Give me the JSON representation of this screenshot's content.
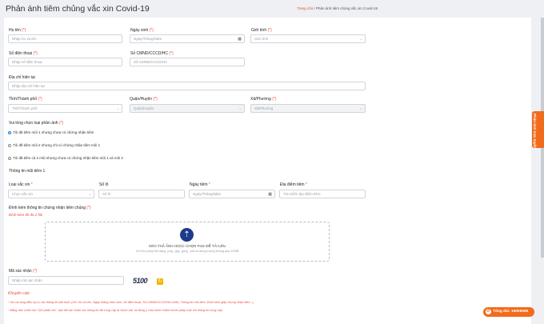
{
  "page": {
    "title": "Phản ánh tiêm chủng vắc xin Covid-19"
  },
  "breadcrumb": {
    "home": "Trang chủ",
    "sep": "/",
    "current": "Phản ánh tiêm chủng vắc xin Covid-19"
  },
  "form": {
    "full_name": {
      "label": "Họ tên",
      "req": "(*)",
      "placeholder": "Nhập họ và tên"
    },
    "dob": {
      "label": "Ngày sinh",
      "req": "(*)",
      "placeholder": "Ngày/Tháng/Năm"
    },
    "gender": {
      "label": "Giới tính",
      "req": "(*)",
      "value": "Giới tính"
    },
    "phone": {
      "label": "Số điện thoại",
      "req": "(*)",
      "placeholder": "Nhập số điện thoại"
    },
    "id_number": {
      "label": "Số CMND/CCCD/HC",
      "req": "(*)",
      "placeholder": "Số CMND/CCCD/HC"
    },
    "address": {
      "label": "Địa chỉ hiện tại",
      "placeholder": "Nhập địa chỉ hiện tại"
    },
    "province": {
      "label": "Tỉnh/Thành phố",
      "req": "(*)",
      "value": "Tỉnh/Thành phố"
    },
    "district": {
      "label": "Quận/Huyện",
      "req": "(*)",
      "value": "Quận/Huyện"
    },
    "ward": {
      "label": "Xã/Phường",
      "req": "(*)",
      "value": "Xã/Phường"
    },
    "report_type": {
      "label": "Vui lòng chọn loại phản ánh",
      "req": "(*)",
      "options": [
        "Tôi đã tiêm mũi 1 nhưng chưa có chứng nhận tiêm",
        "Tôi đã tiêm mũi 2 nhưng chỉ có chứng nhận tiêm mũi 1",
        "Tôi đã tiêm cả 2 mũi nhưng chưa có chứng nhận tiêm mũi 1 và mũi 2"
      ]
    },
    "dose_section": "Thông tin mũi tiêm 1",
    "vaccine": {
      "label": "Loại vắc xin",
      "req": "*",
      "value": "Chọn vắc xin"
    },
    "lot": {
      "label": "Số lô",
      "placeholder": "Số lô"
    },
    "dose_date": {
      "label": "Ngày tiêm",
      "req": "*",
      "placeholder": "Ngày/Tháng/Năm"
    },
    "location": {
      "label": "Địa điểm tiêm",
      "req": "*",
      "placeholder": "Tìm kiếm địa điểm tiêm"
    },
    "attach": {
      "label": "Đính kèm thông tin chứng nhận tiêm chủng",
      "req": "(*)",
      "hint": "Đính kèm tối đa 2 file",
      "drop_title": "KÉO THẢ ẢNH HOẶC CHỌN FILE ĐỂ TẢI LÊN",
      "drop_sub": "Chỉ cho phép file dạng .png, .jpg, .jpeg, .pdf và dung lượng không quá 10MB"
    },
    "captcha": {
      "label": "Mã xác nhận",
      "req": "(*)",
      "placeholder": "Nhập mã xác nhận",
      "code": "5100"
    }
  },
  "notes": {
    "title": "Khuyến cáo:",
    "items": [
      "* Xin vui lòng điền ký tự các thông tin bắt buộc (VD: Họ và tên, Ngày tháng năm sinh, Số điện thoại, Số CMND/CCCD/Hộ chiếu, Thông tin mũi tiêm, Đính kèm giấy chứng nhận tiêm...)",
      "* Bằng việc nhấn nút \"Gửi phản hồi\", bạn đã xác nhận các thông tin đã cung cấp là chính xác và đồng ý chịu trách nhiệm trước pháp luật với thông tin cung cấp."
    ]
  },
  "side_tab": "Phản ánh trực tuyến",
  "hotline": {
    "label": "Tổng đài: 19009095"
  }
}
